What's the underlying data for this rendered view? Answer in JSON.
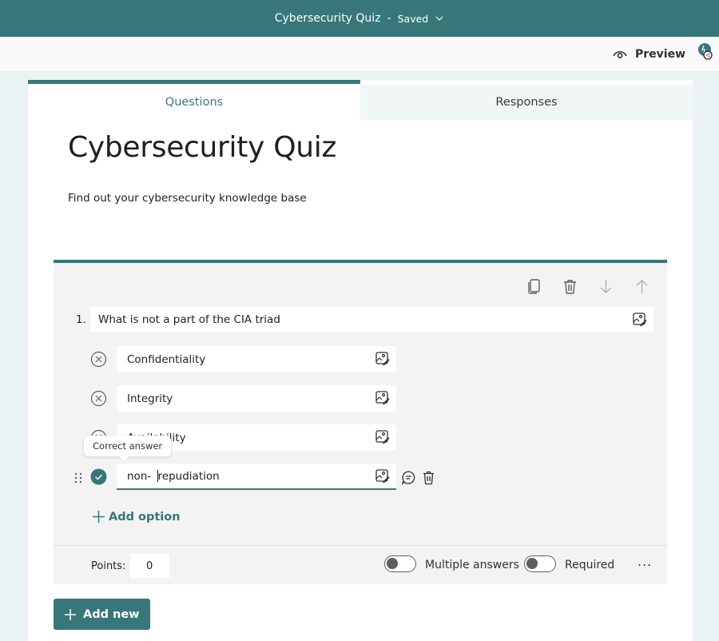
{
  "topbar": {
    "title": "Cybersecurity Quiz",
    "separator": "-",
    "status": "Saved"
  },
  "subbar": {
    "preview_label": "Preview"
  },
  "tabs": [
    {
      "label": "Questions",
      "active": true
    },
    {
      "label": "Responses",
      "active": false
    }
  ],
  "form": {
    "title": "Cybersecurity Quiz",
    "description": "Find out your cybersecurity knowledge base"
  },
  "question": {
    "number": "1.",
    "text": "What is not a part of the CIA triad",
    "options": [
      {
        "label": "Confidentiality",
        "correct": false
      },
      {
        "label": "Integrity",
        "correct": false
      },
      {
        "label": "Availability",
        "correct": false
      },
      {
        "label_before_caret": "non- ",
        "label_after_caret": "repudiation",
        "correct": true
      }
    ],
    "tooltip": "Correct answer",
    "add_option_label": "Add option",
    "points_label": "Points:",
    "points_value": "0",
    "multiple_answers_label": "Multiple answers",
    "multiple_answers_on": false,
    "required_label": "Required",
    "required_on": false,
    "more_label": "..."
  },
  "actions": {
    "add_new_label": "Add new"
  },
  "colors": {
    "brand": "#37777a",
    "background": "#eaf2f3",
    "card": "#f3f3f3"
  }
}
